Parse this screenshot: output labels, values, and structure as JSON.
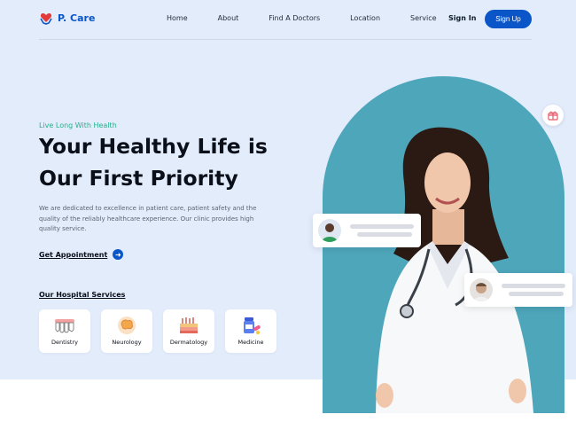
{
  "brand": {
    "name": "P. Care",
    "color": "#0a56c9"
  },
  "nav": {
    "links": [
      "Home",
      "About",
      "Find A Doctors",
      "Location",
      "Service"
    ],
    "signin_label": "Sign In",
    "signup_label": "Sign Up"
  },
  "hero": {
    "tagline": "Live Long With Health",
    "headline_line1": "Your Healthy Life is",
    "headline_line2": "Our First Priority",
    "description": "We are dedicated to excellence in patient care, patient safety and the quality of the reliably healthcare experience. Our clinic provides high quality service.",
    "cta_label": "Get Appointment"
  },
  "services": {
    "title": "Our Hospital Services",
    "items": [
      {
        "label": "Dentistry",
        "icon": "teeth-icon"
      },
      {
        "label": "Neurology",
        "icon": "brain-icon"
      },
      {
        "label": "Dermatology",
        "icon": "skin-icon"
      },
      {
        "label": "Medicine",
        "icon": "pill-bottle-icon"
      }
    ]
  },
  "colors": {
    "hero_bg": "#e2ecfb",
    "accent_green": "#22b08a",
    "arch": "#4ea6ba"
  }
}
